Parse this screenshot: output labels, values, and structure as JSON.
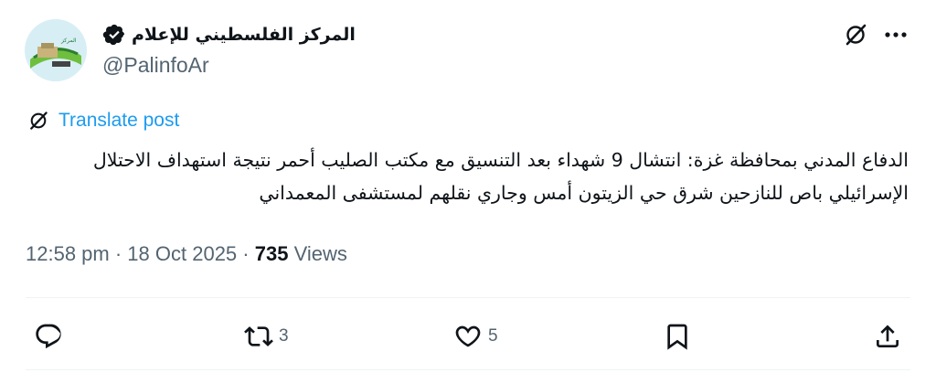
{
  "author": {
    "display_name": "المركز الفلسطيني للإعلام",
    "handle": "@PalinfoAr",
    "verified": true,
    "avatar_icon": "palinfo-logo"
  },
  "top_actions": [
    "grok-icon",
    "more-icon"
  ],
  "translate": {
    "label": "Translate post"
  },
  "post": {
    "line1": "الدفاع المدني بمحافظة غزة: انتشال 9 شهداء بعد التنسيق مع مكتب الصليب أحمر  نتيجة استهداف الاحتلال",
    "line2": "الإسرائيلي باص للنازحين شرق حي الزيتون أمس وجاري نقلهم لمستشفى المعمداني"
  },
  "meta": {
    "time": "12:58 pm",
    "separator": " · ",
    "date": "18 Oct 2025",
    "views_count": "735",
    "views_label": "Views"
  },
  "actions": {
    "reply_count": "",
    "repost_count": "3",
    "like_count": "5"
  },
  "colors": {
    "accent": "#1d9bf0",
    "secondary_text": "#536471",
    "verified_badge": "#0f1419"
  }
}
